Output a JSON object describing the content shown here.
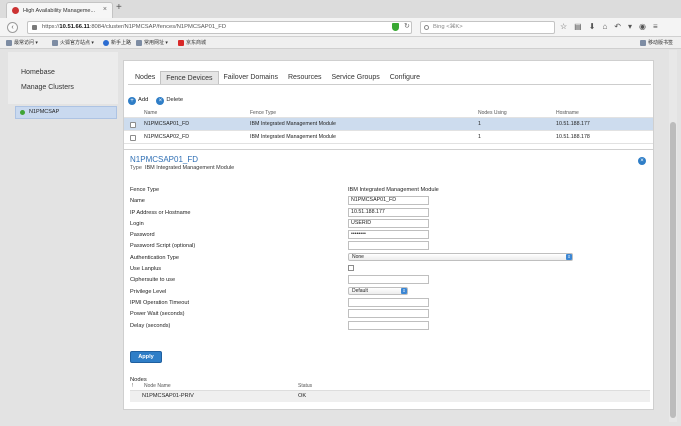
{
  "browser": {
    "tab_title": "High Availability Manageme...",
    "url_prefix": "https://",
    "url_host": "10.51.66.11",
    "url_rest": ":8084/cluster/N1PMCSAP/fences/N1PMCSAP01_FD",
    "search_placeholder": "Bing <⌘K>",
    "bookmarks": [
      {
        "label": "最常访问 ▾"
      },
      {
        "label": "火狐官方站点 ▾"
      },
      {
        "label": "新手上路"
      },
      {
        "label": "常用网址 ▾"
      },
      {
        "label": "京东商城"
      }
    ],
    "mobile_bookmarks": "移动版书签"
  },
  "sidebar": {
    "homebase": "Homebase",
    "manage_clusters": "Manage Clusters",
    "cluster": "N1PMCSAP"
  },
  "tabs": [
    "Nodes",
    "Fence Devices",
    "Failover Domains",
    "Resources",
    "Service Groups",
    "Configure"
  ],
  "actions": {
    "add": "Add",
    "delete": "Delete"
  },
  "table": {
    "headers": [
      "Name",
      "Fence Type",
      "Nodes Using",
      "Hostname"
    ],
    "rows": [
      [
        "N1PMCSAP01_FD",
        "IBM Integrated Management Module",
        "1",
        "10.51.188.177"
      ],
      [
        "N1PMCSAP02_FD",
        "IBM Integrated Management Module",
        "1",
        "10.51.188.178"
      ]
    ]
  },
  "detail": {
    "title": "N1PMCSAP01_FD",
    "type_label": "Type",
    "type_value": "IBM Integrated Management Module",
    "fields": {
      "fence_type": {
        "label": "Fence Type",
        "value": "IBM Integrated Management Module"
      },
      "name": {
        "label": "Name",
        "value": "N1PMCSAP01_FD"
      },
      "ip": {
        "label": "IP Address or Hostname",
        "value": "10.51.188.177"
      },
      "login": {
        "label": "Login",
        "value": "USERID"
      },
      "password": {
        "label": "Password",
        "value": "••••••••"
      },
      "password_script": {
        "label": "Password Script (optional)",
        "value": ""
      },
      "auth_type": {
        "label": "Authentication Type",
        "value": "None"
      },
      "use_lanplus": {
        "label": "Use Lanplus"
      },
      "ciphersuite": {
        "label": "Ciphersuite to use",
        "value": ""
      },
      "privilege": {
        "label": "Privilege Level",
        "value": "Default"
      },
      "ipmi_timeout": {
        "label": "IPMI Operation Timeout",
        "value": ""
      },
      "power_wait": {
        "label": "Power Wait (seconds)",
        "value": ""
      },
      "delay": {
        "label": "Delay (seconds)",
        "value": ""
      }
    },
    "apply": "Apply",
    "nodes": {
      "title": "Nodes",
      "headers": [
        "!",
        "Node Name",
        "Status"
      ],
      "rows": [
        [
          "N1PMCSAP01-PRIV",
          "OK"
        ]
      ]
    }
  }
}
